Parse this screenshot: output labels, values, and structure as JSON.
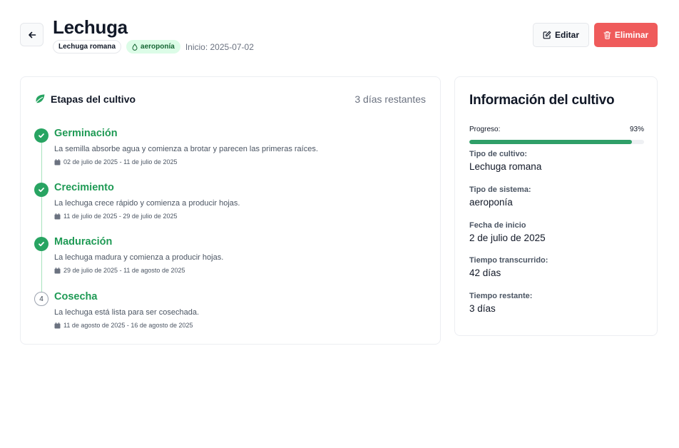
{
  "header": {
    "title": "Lechuga",
    "variety_badge": "Lechuga romana",
    "system_badge": "aeroponía",
    "start_text": "Inicio: 2025-07-02",
    "edit_label": "Editar",
    "delete_label": "Eliminar"
  },
  "stages_card": {
    "title": "Etapas del cultivo",
    "days_remaining": "3 días restantes",
    "stages": [
      {
        "name": "Germinación",
        "description": "La semilla absorbe agua y comienza a brotar y parecen las primeras raíces.",
        "dates": "02 de julio de 2025 - 11 de julio de 2025",
        "status": "completed"
      },
      {
        "name": "Crecimiento",
        "description": "La lechuga crece rápido y comienza a producir hojas.",
        "dates": "11 de julio de 2025 - 29 de julio de 2025",
        "status": "completed"
      },
      {
        "name": "Maduración",
        "description": "La lechuga madura y comienza a producir hojas.",
        "dates": "29 de julio de 2025 - 11 de agosto de 2025",
        "status": "completed"
      },
      {
        "name": "Cosecha",
        "number": "4",
        "description": "La lechuga está lista para ser cosechada.",
        "dates": "11 de agosto de 2025 - 16 de agosto de 2025",
        "status": "pending"
      }
    ]
  },
  "info_card": {
    "title": "Información del cultivo",
    "progress_label": "Progreso:",
    "progress_text": "93%",
    "progress_value": 0.93,
    "crop_type_label": "Tipo de cultivo:",
    "crop_type_value": "Lechuga romana",
    "system_type_label": "Tipo de sistema:",
    "system_type_value": "aeroponía",
    "start_date_label": "Fecha de inicio",
    "start_date_value": "2 de julio de 2025",
    "elapsed_label": "Tiempo transcurrido:",
    "elapsed_value": "42 días",
    "remaining_label": "Tiempo restante:",
    "remaining_value": "3 días"
  },
  "colors": {
    "accent_green": "#1f9a55",
    "progress_green": "#2f9f68",
    "delete_red": "#ef5b5b",
    "badge_green_bg": "#dcfce7"
  },
  "icons": {
    "back": "arrow-left-icon",
    "edit": "pencil-square-icon",
    "delete": "trash-icon",
    "system": "droplet-icon",
    "stages": "leaf-icon",
    "completed": "check-circle-icon",
    "dates": "calendar-icon"
  }
}
